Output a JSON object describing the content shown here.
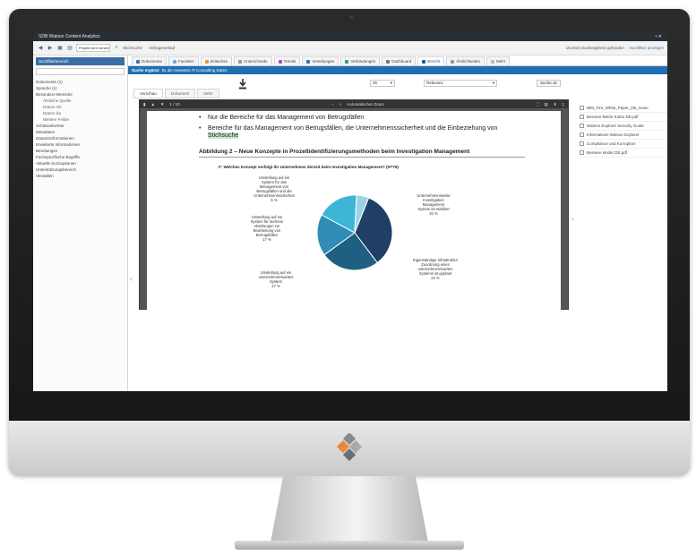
{
  "window": {
    "title": "SDB Watson Content Analytics"
  },
  "toolbar": {
    "search_value": "Projekt wird verwendet",
    "query_label": "Stichsuche",
    "saved_label": "Abfrageverlauf",
    "status_text": "18.2023 Suchergebnis gefunden",
    "refresh_link": "Suchfilter anzeigen"
  },
  "sidebar": {
    "header": "Suchfilterbereich",
    "items": [
      "Dokumente (1)",
      "Sprache (1)",
      "Besondere Bereiche",
      "Ähnliche Quelle",
      "Datum mit",
      "Datum bis",
      "Weitere Felder",
      "Schlüsselwörter",
      "Metadaten",
      "Datumsinformationen",
      "Erweiterte Informationen",
      "Bereitungen",
      "Fachspezifische Begriffe",
      "Aktuelle Suchoptionen",
      "Unterstützungsbereich",
      "Verwalten"
    ]
  },
  "tabs": [
    {
      "label": "Dokumente",
      "color": "#3a73b0"
    },
    {
      "label": "Facetten",
      "color": "#7aa8d6"
    },
    {
      "label": "Zeitachse",
      "color": "#e0a030"
    },
    {
      "label": "Unterscheide",
      "color": "#6cb56c"
    },
    {
      "label": "Trends",
      "color": "#9b59b6"
    },
    {
      "label": "Verteilungen",
      "color": "#3a73b0"
    },
    {
      "label": "Verbindungen",
      "color": "#2d9c9c"
    },
    {
      "label": "Dashboard",
      "color": "#777777"
    },
    {
      "label": "Bericht",
      "color": "#1f5a96"
    },
    {
      "label": "Ähnlichkeiten",
      "color": "#999999"
    },
    {
      "label": "Mehr",
      "color": "#bbbbbb"
    }
  ],
  "bluebar": {
    "bold": "Suche ergänzt",
    "text": "by die neuesten IT-Consulting Daten"
  },
  "controls": {
    "select1": "25",
    "select2": "Relevanz",
    "button": "Suche ok"
  },
  "subtabs": [
    "Vorschau",
    "Dokument",
    "Mehr"
  ],
  "viewer": {
    "page": "1 / 10",
    "zoom": "Automatischer Zoom"
  },
  "document": {
    "bullet1": "Nur die Bereiche für das Management von Betrugsfällen",
    "bullet2_a": "Bereiche für das Management von Betrugsfällen, die Unternehmenssicherheit und die Einbeziehung von ",
    "bullet2_hl": "Stichsuche",
    "figure_title": "Abbildung 2 – Neue Konzepte in Prozeßidentifizierungsmethoden beim Investigation Management",
    "figure_question": "F: Welches Konzept verfolgt Ihr Unternehmen derzeit beim Investigation Management? (N=76)"
  },
  "chart_data": {
    "type": "pie",
    "title": "F: Welches Konzept verfolgt Ihr Unternehmen derzeit beim Investigation Management? (N=76)",
    "series": [
      {
        "label": "Unternehmensweite Investigation Management System ist etabliert",
        "value": 32,
        "color": "#1f3f66"
      },
      {
        "label": "Eigenständige Infrastruktur Zuordnung eines unternehmensweiten Systems ist geplant",
        "value": 24,
        "color": "#1e5f82"
      },
      {
        "label": "Umstellung auf ein unternehmensweites System",
        "value": 17,
        "color": "#2f8db8"
      },
      {
        "label": "Umstellung auf ein System für mehrere Abteilungen zur Bearbeitung von Betrugsfällen",
        "value": 17,
        "color": "#3db5d6"
      },
      {
        "label": "Umstellung auf ein System für das Management von Betrugsfällen und die Unternehmenssicherheit",
        "value": 5,
        "color": "#9bd3e6"
      }
    ],
    "labels_text": {
      "a": [
        "Unternehmensweite",
        "Investigation",
        "Management",
        "System ist etabliert",
        "32 %"
      ],
      "b": [
        "Eigenständige Infrastruktur",
        "Zuordnung eines",
        "unternehmensweiten",
        "Systems ist geplant",
        "24 %"
      ],
      "c": [
        "Umstellung auf ein",
        "unternehmensweites",
        "System",
        "17 %"
      ],
      "d": [
        "Umstellung auf ein",
        "System für mehrere",
        "Abteilungen zur",
        "Bearbeitung von",
        "Betrugsfällen",
        "17 %"
      ],
      "e": [
        "Umstellung auf ein",
        "System für das",
        "Management von",
        "Betrugsfällen und die",
        "Unternehmenssicherheit",
        "5 %"
      ]
    }
  },
  "files": [
    "IBM_Fire_White_Paper_DE_Issue",
    "Bessere Betrie Kultur DE.pdf",
    "Watson Explorer Security Guide",
    "Informatives Watson Explorer",
    "Compliance und Korruption",
    "Bessere kinder DE.pdf"
  ],
  "icons": {
    "back": "arrow-left-icon",
    "forward": "arrow-right-icon",
    "save": "save-icon",
    "print": "print-icon",
    "search": "search-icon",
    "download": "download-icon",
    "brand": "diamond-logo-icon"
  }
}
